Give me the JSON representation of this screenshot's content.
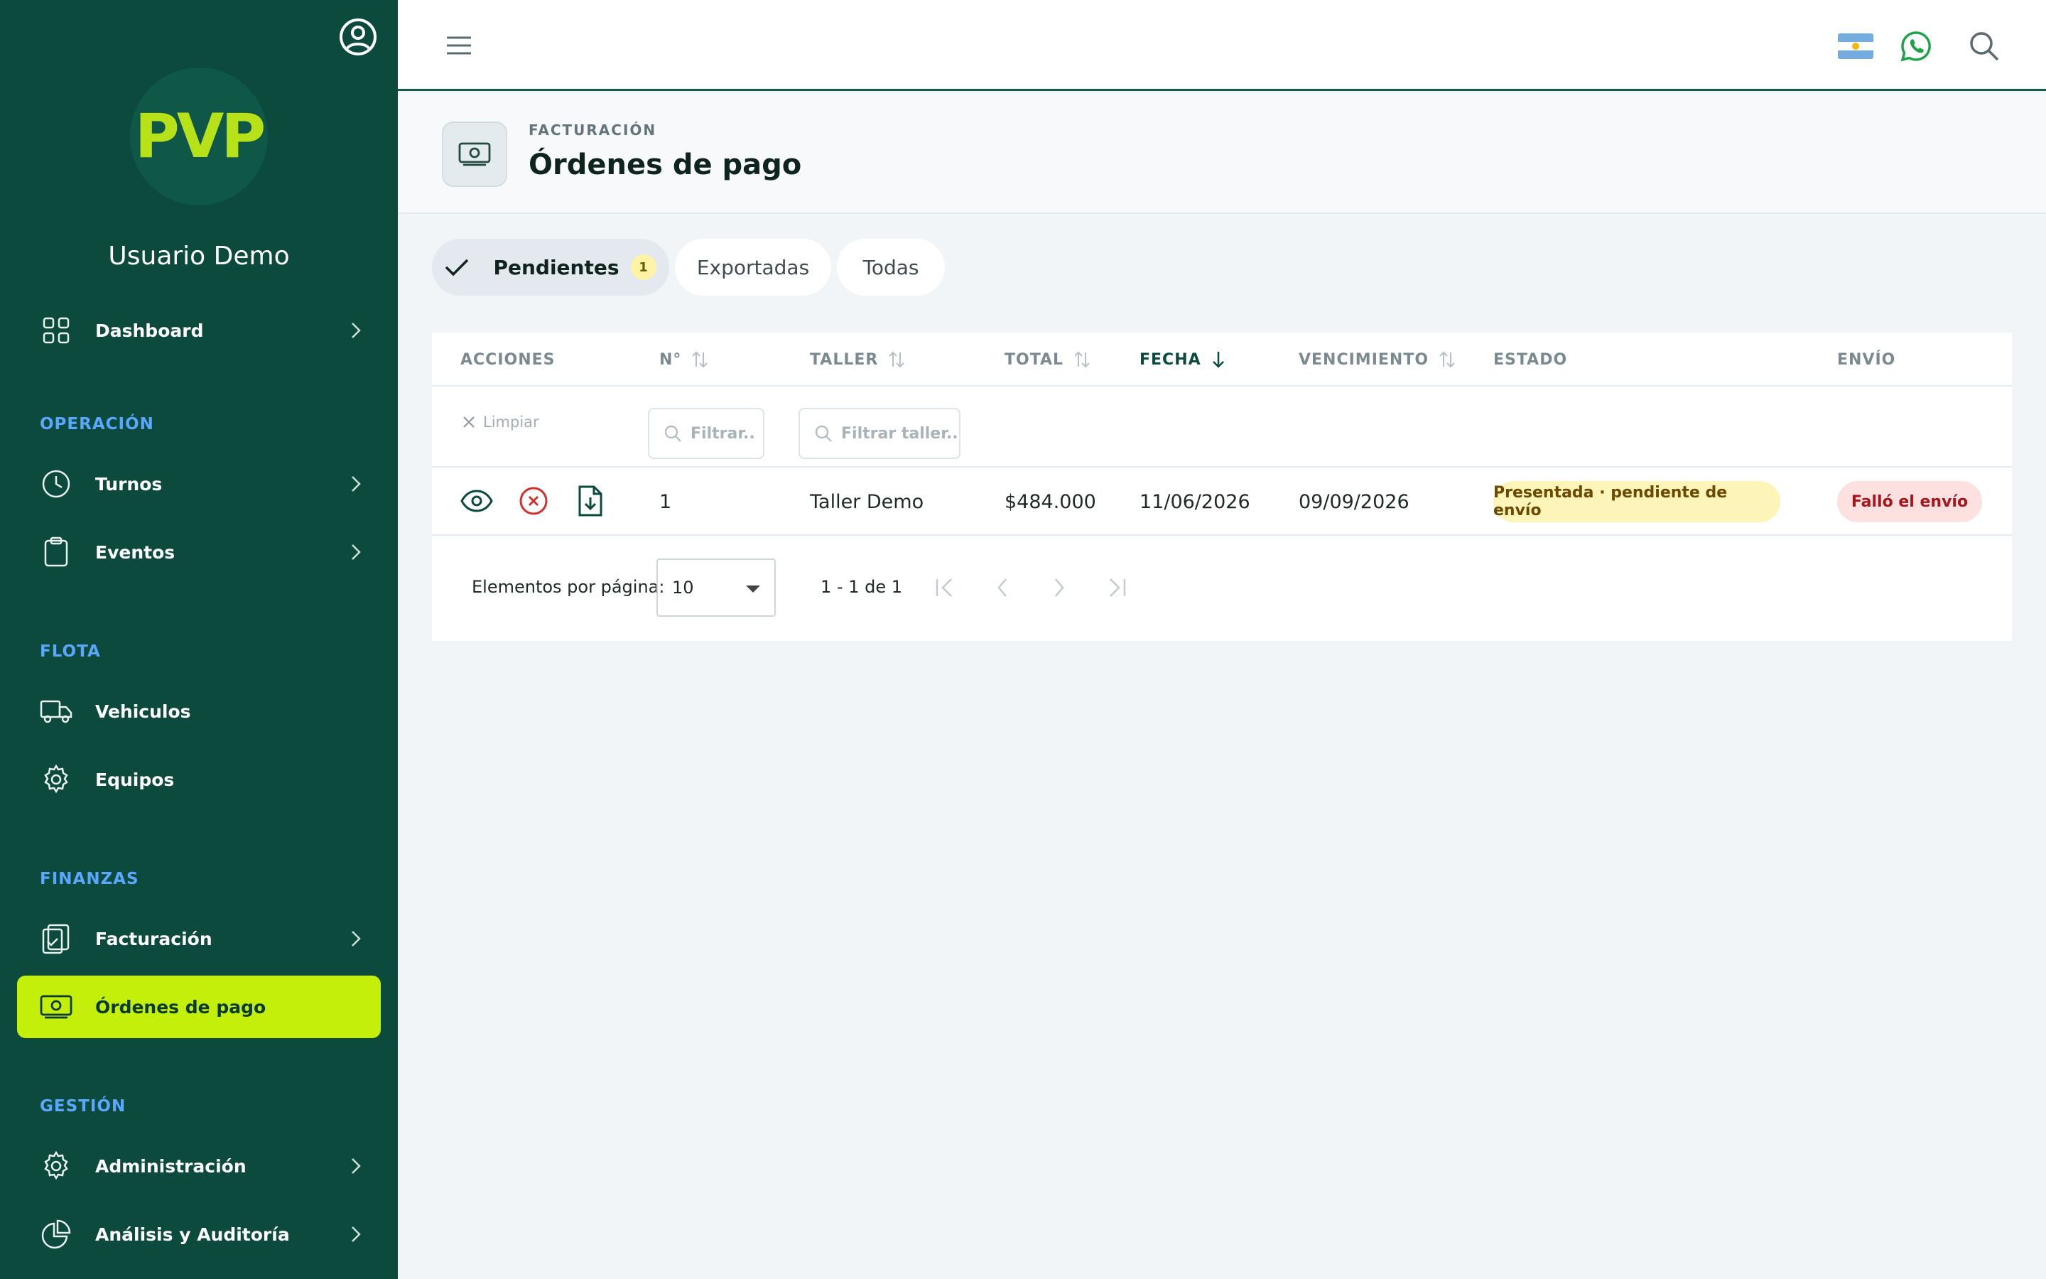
{
  "sidebar": {
    "logo_text": "PVP",
    "user_name": "Usuario Demo",
    "items": [
      {
        "label": "Dashboard",
        "icon": "grid-icon"
      },
      {
        "label": "Turnos",
        "icon": "clock-icon"
      },
      {
        "label": "Eventos",
        "icon": "clipboard-icon"
      },
      {
        "label": "Vehiculos",
        "icon": "truck-icon"
      },
      {
        "label": "Equipos",
        "icon": "gear-icon"
      },
      {
        "label": "Facturación",
        "icon": "clipboard-check-icon"
      },
      {
        "label": "Órdenes de pago",
        "icon": "money-icon"
      },
      {
        "label": "Administración",
        "icon": "gear-icon"
      },
      {
        "label": "Análisis y Auditoría",
        "icon": "pie-chart-icon"
      }
    ],
    "sections": {
      "operacion": "OPERACIÓN",
      "flota": "FLOTA",
      "finanzas": "FINANZAS",
      "gestion": "GESTIÓN"
    }
  },
  "header": {
    "section": "FACTURACIÓN",
    "title": "Órdenes de pago"
  },
  "tabs": [
    {
      "label": "Pendientes",
      "badge": "1",
      "active": true
    },
    {
      "label": "Exportadas",
      "active": false
    },
    {
      "label": "Todas",
      "active": false
    }
  ],
  "table": {
    "columns": [
      "ACCIONES",
      "N°",
      "TALLER",
      "TOTAL",
      "FECHA",
      "VENCIMIENTO",
      "ESTADO",
      "ENVÍO"
    ],
    "filters": {
      "clear_label": "Limpiar",
      "number_placeholder": "Filtrar..",
      "taller_placeholder": "Filtrar taller.."
    },
    "rows": [
      {
        "numero": "1",
        "taller": "Taller Demo",
        "total": "$484.000",
        "fecha": "11/06/2026",
        "vencimiento": "09/09/2026",
        "estado": "Presentada · pendiente de envío",
        "envio": "Falló el envío"
      }
    ]
  },
  "pager": {
    "label": "Elementos por página:",
    "page_size": "10",
    "range": "1 - 1 de 1"
  },
  "colors": {
    "sidebar_bg": "#0b4a3c",
    "accent": "#c3ef0a",
    "section_label": "#5aa7ff"
  }
}
